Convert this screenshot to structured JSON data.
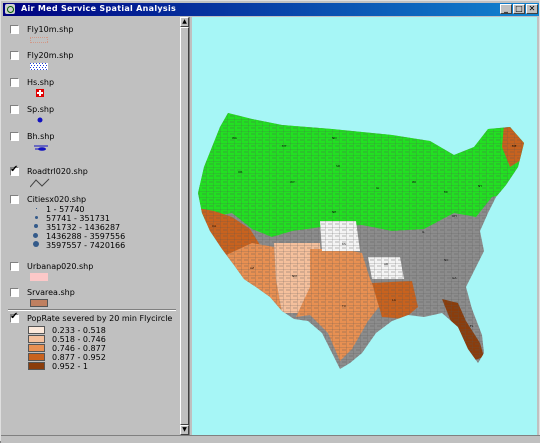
{
  "window": {
    "title": "Air Med Service Spatial Analysis",
    "buttons": {
      "minimize": "_",
      "maximize": "□",
      "close": "✕"
    }
  },
  "toc": {
    "layers": [
      {
        "name": "Fly10m.shp",
        "checked": false
      },
      {
        "name": "Fly20m.shp",
        "checked": false
      },
      {
        "name": "Hs.shp",
        "checked": false
      },
      {
        "name": "Sp.shp",
        "checked": false
      },
      {
        "name": "Bh.shp",
        "checked": false
      },
      {
        "name": "Roadtrl020.shp",
        "checked": true
      },
      {
        "name": "Citiesx020.shp",
        "checked": false,
        "legend": [
          "1 - 57740",
          "57741 - 351731",
          "351732 - 1436287",
          "1436288 - 3597556",
          "3597557 - 7420166"
        ]
      },
      {
        "name": "Urbanap020.shp",
        "checked": false
      },
      {
        "name": "Srvarea.shp",
        "checked": false
      },
      {
        "name": "PopRate severed by 20 min Flycircle",
        "checked": true,
        "legend": [
          {
            "label": "0.233 - 0.518",
            "color": "#fce9db"
          },
          {
            "label": "0.518 - 0.746",
            "color": "#f5c09c"
          },
          {
            "label": "0.746 - 0.877",
            "color": "#e89052"
          },
          {
            "label": "0.877 - 0.952",
            "color": "#c8621e"
          },
          {
            "label": "0.952 - 1",
            "color": "#8a3d0c"
          }
        ]
      }
    ]
  },
  "map": {
    "background": "#a6f6f6",
    "colors": {
      "green": "#22e022",
      "gray": "#8c8c8c",
      "white": "#f4f4f4",
      "light": "#f5c09c",
      "mid": "#e89052",
      "dark": "#c8621e",
      "darkest": "#8a3d0c"
    }
  }
}
